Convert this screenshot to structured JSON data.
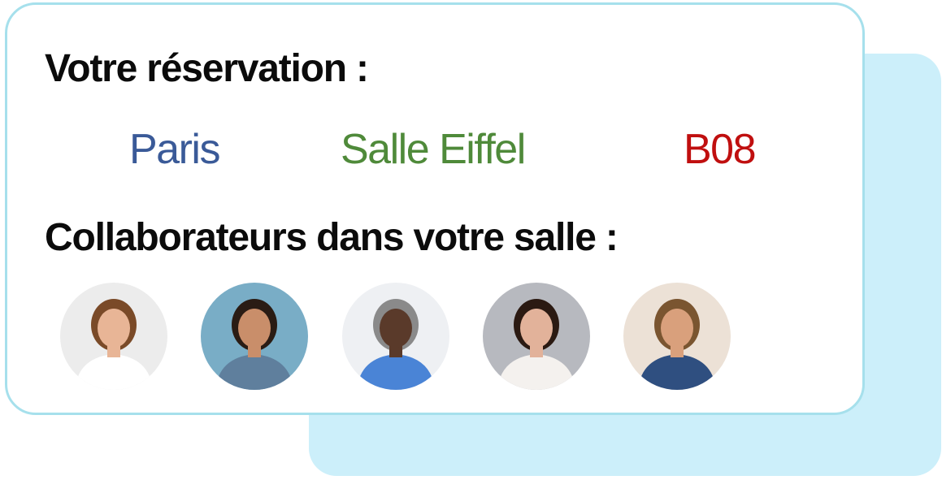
{
  "reservation": {
    "title": "Votre réservation :",
    "city": "Paris",
    "room": "Salle Eiffel",
    "desk": "B08",
    "colors": {
      "city": "#3a5a98",
      "room": "#4f8a3a",
      "desk": "#c00f0f"
    }
  },
  "collaborators": {
    "title": "Collaborateurs dans votre salle :",
    "avatars": [
      {
        "name": "avatar-woman-glasses",
        "bg": "#ececec",
        "skin": "#e8b596",
        "hair": "#7a4a28",
        "shirt": "#ffffff"
      },
      {
        "name": "avatar-man-tshirt",
        "bg": "#79adc6",
        "skin": "#c98e6a",
        "hair": "#2a1c14",
        "shirt": "#5f7f9d"
      },
      {
        "name": "avatar-man-plaid",
        "bg": "#eef0f3",
        "skin": "#5a3a2a",
        "hair": "#8a8a8a",
        "shirt": "#4a84d6"
      },
      {
        "name": "avatar-woman-dark-hair",
        "bg": "#b7b9bf",
        "skin": "#e2b29a",
        "hair": "#2b1a12",
        "shirt": "#f4f1ee"
      },
      {
        "name": "avatar-man-sweater",
        "bg": "#ece1d6",
        "skin": "#d9a07c",
        "hair": "#7a5530",
        "shirt": "#2f4f80"
      }
    ]
  }
}
